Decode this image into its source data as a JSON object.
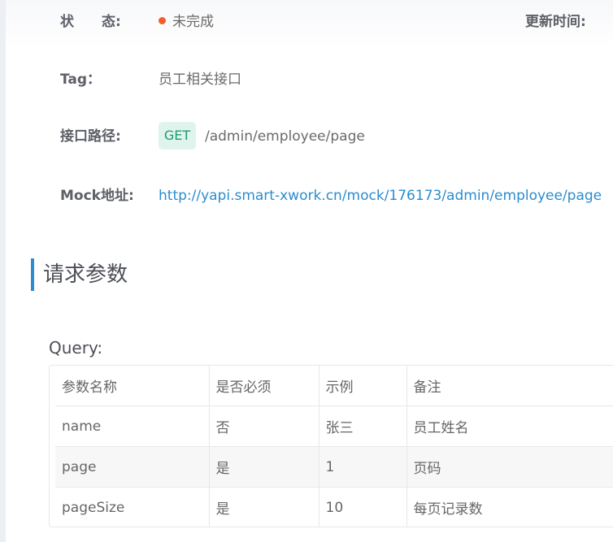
{
  "info": {
    "status_label": "状　　态:",
    "status_value": "未完成",
    "status_color": "#f0602a",
    "update_label": "更新时间:",
    "tag_label": "Tag：",
    "tag_value": "员工相关接口",
    "path_label": "接口路径:",
    "method": "GET",
    "method_bg": "#dff4ec",
    "method_color": "#1b9b70",
    "path": "/admin/employee/page",
    "mock_label": "Mock地址:",
    "mock_url": "http://yapi.smart-xwork.cn/mock/176173/admin/employee/page",
    "link_color": "#2b8ccf"
  },
  "section": {
    "title": "请求参数",
    "accent_color": "#2b8ccf"
  },
  "query": {
    "label": "Query:",
    "columns": [
      "参数名称",
      "是否必须",
      "示例",
      "备注"
    ],
    "rows": [
      [
        "name",
        "否",
        "张三",
        "员工姓名"
      ],
      [
        "page",
        "是",
        "1",
        "页码"
      ],
      [
        "pageSize",
        "是",
        "10",
        "每页记录数"
      ]
    ]
  }
}
